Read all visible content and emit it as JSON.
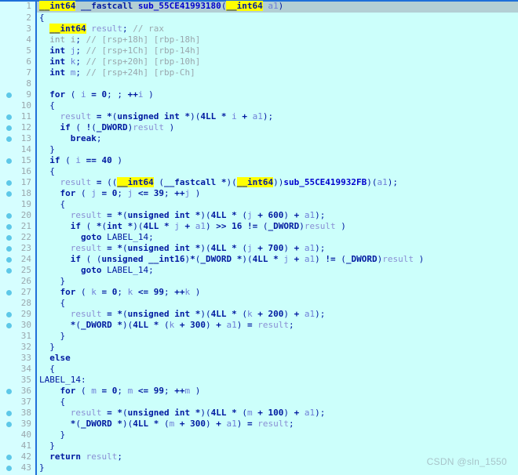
{
  "editor": {
    "title": "IDA Pseudocode View",
    "language": "c-pseudocode",
    "background_color": "#ccfffb",
    "gutter_color": "#d6feff",
    "gutter_rule_color": "#1e6fd9",
    "selection_color": "#b3cfd4",
    "highlight_color": "#ffff00",
    "first_line": 1,
    "last_line": 43,
    "total_lines": 43,
    "selected_line": 1,
    "highlighted_token": "__int64",
    "function_name": "sub_55CE41993180",
    "called_function": "sub_55CE419932FB",
    "label_name": "LABEL_14"
  },
  "watermark": {
    "text": "CSDN @sln_1550"
  },
  "lines": [
    {
      "n": 1,
      "dot": false,
      "selected": true,
      "text": "__int64 __fastcall sub_55CE41993180(__int64 a1)"
    },
    {
      "n": 2,
      "dot": false,
      "selected": false,
      "text": "{"
    },
    {
      "n": 3,
      "dot": false,
      "selected": false,
      "text": "  __int64 result; // rax"
    },
    {
      "n": 4,
      "dot": false,
      "selected": false,
      "text": "  int i; // [rsp+18h] [rbp-18h]"
    },
    {
      "n": 5,
      "dot": false,
      "selected": false,
      "text": "  int j; // [rsp+1Ch] [rbp-14h]"
    },
    {
      "n": 6,
      "dot": false,
      "selected": false,
      "text": "  int k; // [rsp+20h] [rbp-10h]"
    },
    {
      "n": 7,
      "dot": false,
      "selected": false,
      "text": "  int m; // [rsp+24h] [rbp-Ch]"
    },
    {
      "n": 8,
      "dot": false,
      "selected": false,
      "text": ""
    },
    {
      "n": 9,
      "dot": true,
      "selected": false,
      "text": "  for ( i = 0; ; ++i )"
    },
    {
      "n": 10,
      "dot": false,
      "selected": false,
      "text": "  {"
    },
    {
      "n": 11,
      "dot": true,
      "selected": false,
      "text": "    result = *(unsigned int *)(4LL * i + a1);"
    },
    {
      "n": 12,
      "dot": true,
      "selected": false,
      "text": "    if ( !(_DWORD)result )"
    },
    {
      "n": 13,
      "dot": true,
      "selected": false,
      "text": "      break;"
    },
    {
      "n": 14,
      "dot": false,
      "selected": false,
      "text": "  }"
    },
    {
      "n": 15,
      "dot": true,
      "selected": false,
      "text": "  if ( i == 40 )"
    },
    {
      "n": 16,
      "dot": false,
      "selected": false,
      "text": "  {"
    },
    {
      "n": 17,
      "dot": true,
      "selected": false,
      "text": "    result = ((__int64 (__fastcall *)(__int64))sub_55CE419932FB)(a1);"
    },
    {
      "n": 18,
      "dot": true,
      "selected": false,
      "text": "    for ( j = 0; j <= 39; ++j )"
    },
    {
      "n": 19,
      "dot": false,
      "selected": false,
      "text": "    {"
    },
    {
      "n": 20,
      "dot": true,
      "selected": false,
      "text": "      result = *(unsigned int *)(4LL * (j + 600) + a1);"
    },
    {
      "n": 21,
      "dot": true,
      "selected": false,
      "text": "      if ( *(int *)(4LL * j + a1) >> 16 != (_DWORD)result )"
    },
    {
      "n": 22,
      "dot": true,
      "selected": false,
      "text": "        goto LABEL_14;"
    },
    {
      "n": 23,
      "dot": true,
      "selected": false,
      "text": "      result = *(unsigned int *)(4LL * (j + 700) + a1);"
    },
    {
      "n": 24,
      "dot": true,
      "selected": false,
      "text": "      if ( (unsigned __int16)*(_DWORD *)(4LL * j + a1) != (_DWORD)result )"
    },
    {
      "n": 25,
      "dot": true,
      "selected": false,
      "text": "        goto LABEL_14;"
    },
    {
      "n": 26,
      "dot": false,
      "selected": false,
      "text": "    }"
    },
    {
      "n": 27,
      "dot": true,
      "selected": false,
      "text": "    for ( k = 0; k <= 99; ++k )"
    },
    {
      "n": 28,
      "dot": false,
      "selected": false,
      "text": "    {"
    },
    {
      "n": 29,
      "dot": true,
      "selected": false,
      "text": "      result = *(unsigned int *)(4LL * (k + 200) + a1);"
    },
    {
      "n": 30,
      "dot": true,
      "selected": false,
      "text": "      *(_DWORD *)(4LL * (k + 300) + a1) = result;"
    },
    {
      "n": 31,
      "dot": false,
      "selected": false,
      "text": "    }"
    },
    {
      "n": 32,
      "dot": false,
      "selected": false,
      "text": "  }"
    },
    {
      "n": 33,
      "dot": false,
      "selected": false,
      "text": "  else"
    },
    {
      "n": 34,
      "dot": false,
      "selected": false,
      "text": "  {"
    },
    {
      "n": 35,
      "dot": false,
      "selected": false,
      "text": "LABEL_14:"
    },
    {
      "n": 36,
      "dot": true,
      "selected": false,
      "text": "    for ( m = 0; m <= 99; ++m )"
    },
    {
      "n": 37,
      "dot": false,
      "selected": false,
      "text": "    {"
    },
    {
      "n": 38,
      "dot": true,
      "selected": false,
      "text": "      result = *(unsigned int *)(4LL * (m + 100) + a1);"
    },
    {
      "n": 39,
      "dot": true,
      "selected": false,
      "text": "      *(_DWORD *)(4LL * (m + 300) + a1) = result;"
    },
    {
      "n": 40,
      "dot": false,
      "selected": false,
      "text": "    }"
    },
    {
      "n": 41,
      "dot": false,
      "selected": false,
      "text": "  }"
    },
    {
      "n": 42,
      "dot": true,
      "selected": false,
      "text": "  return result;"
    },
    {
      "n": 43,
      "dot": true,
      "selected": false,
      "text": "}"
    }
  ]
}
